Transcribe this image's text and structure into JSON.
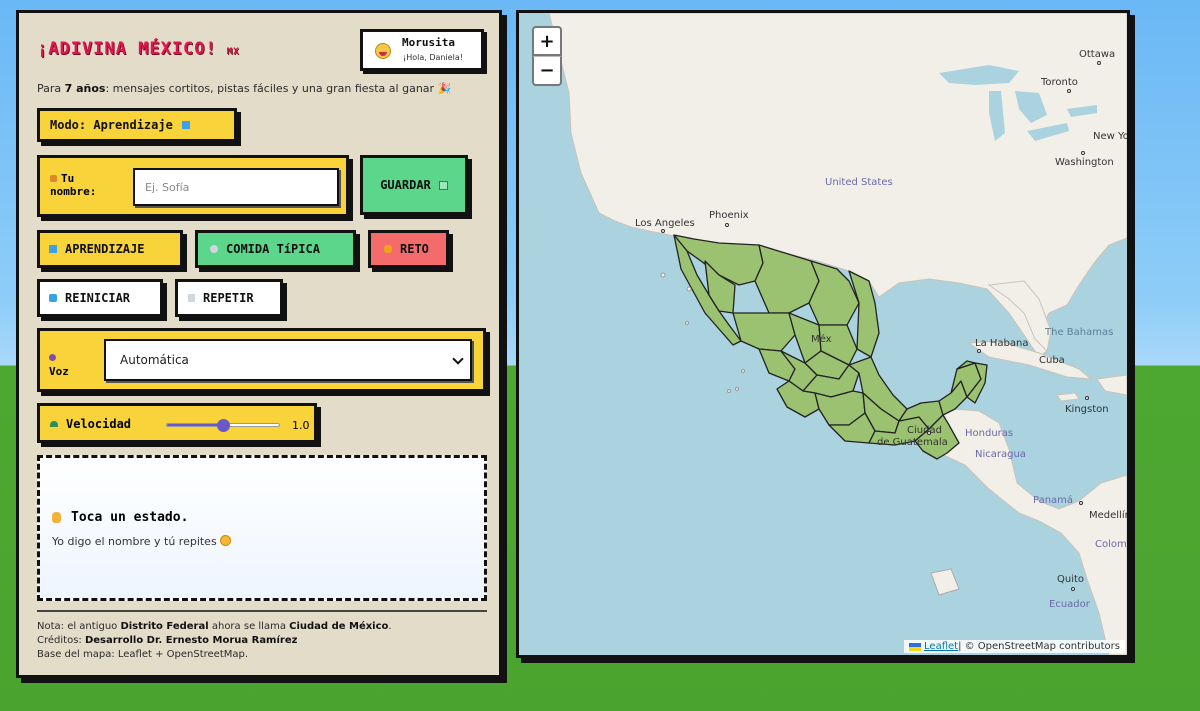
{
  "app": {
    "title": "¡ADIVINA MÉXICO!",
    "title_tag": "MX",
    "subtitle_prefix": "Para ",
    "subtitle_age": "7 años",
    "subtitle_rest": ": mensajes cortitos, pistas fáciles y una gran fiesta al ganar 🎉"
  },
  "user": {
    "name": "Morusita",
    "greeting": "¡Hola, Daniela!",
    "icon": "smiley-icon"
  },
  "mode": {
    "label": "Modo: Aprendizaje",
    "icon": "book-icon"
  },
  "name_field": {
    "label_line1": "Tu",
    "label_line2": "nombre:",
    "placeholder": "Ej. Sofía",
    "value": "",
    "save_label": "GUARDAR"
  },
  "buttons": {
    "learn": "APRENDIZAJE",
    "food": "COMIDA TíPICA",
    "challenge": "RETO",
    "reset": "REINICIAR",
    "repeat": "REPETIR"
  },
  "voice": {
    "label": "Voz",
    "selected": "Automática"
  },
  "speed": {
    "label": "Velocidad",
    "value": 1.0,
    "display": "1.0",
    "min": 0.5,
    "max": 1.5
  },
  "feedback": {
    "heading": "Toca un estado.",
    "sub": "Yo digo el nombre y tú repites"
  },
  "footer": {
    "note_prefix": "Nota: el antiguo ",
    "note_old": "Distrito Federal",
    "note_mid": " ahora se llama ",
    "note_new": "Ciudad de México",
    "note_end": ".",
    "credits_prefix": "Créditos: ",
    "credits_name": "Desarrollo Dr. Ernesto Morua Ramírez",
    "basemap": "Base del mapa: Leaflet + OpenStreetMap."
  },
  "map": {
    "zoom_in": "+",
    "zoom_out": "−",
    "labels": {
      "ottawa": "Ottawa",
      "toronto": "Toronto",
      "new_york": "New Yor",
      "washington": "Washington",
      "united_states": "United States",
      "los_angeles": "Los Angeles",
      "phoenix": "Phoenix",
      "the_bahamas": "The Bahamas",
      "la_habana": "La Habana",
      "cuba": "Cuba",
      "kingston": "Kingston",
      "ciudad_de_guatemala_1": "Ciudad",
      "ciudad_de_guatemala_2": "de Guatemala",
      "honduras": "Honduras",
      "nicaragua": "Nicaragua",
      "panama": "Panamá",
      "medellin": "Medellín",
      "colombia": "Colombia",
      "quito": "Quito",
      "ecuador": "Ecuador",
      "mexico_partial": "Méx"
    },
    "attribution_leaflet": "Leaflet",
    "attribution_rest": " | © OpenStreetMap contributors",
    "colors": {
      "sea": "#aad3df",
      "land": "#f2efe9",
      "states": "#9ac271",
      "border": "#222"
    }
  }
}
